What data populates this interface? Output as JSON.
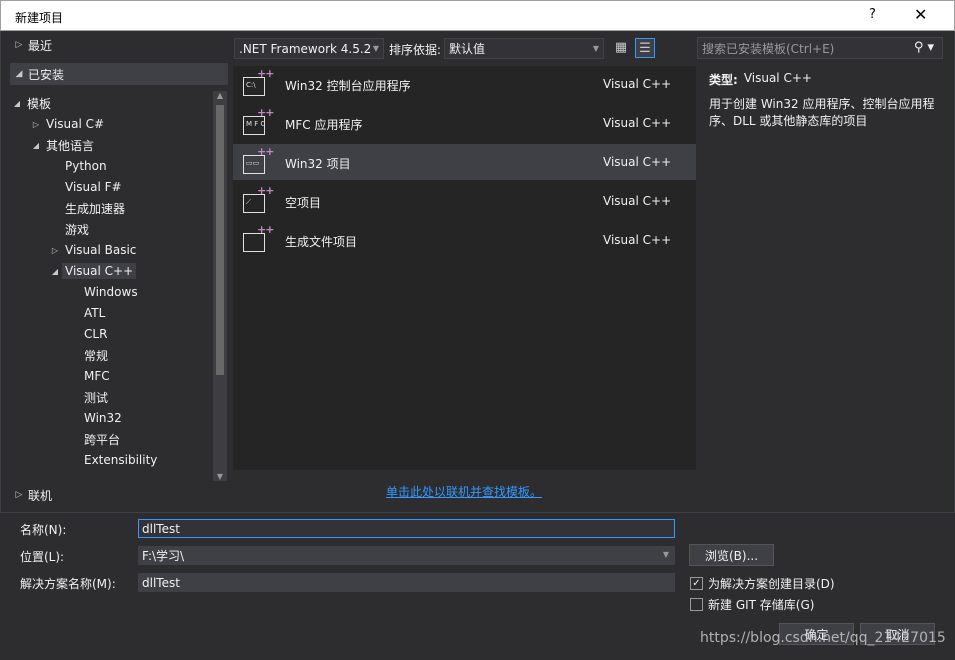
{
  "window": {
    "title": "新建项目",
    "help": "?",
    "close": "✕"
  },
  "left": {
    "recent": "最近",
    "installed": "已安装",
    "online": "联机",
    "tree": [
      {
        "label": "模板",
        "arrow": "◢"
      },
      {
        "label": "Visual C#",
        "arrow": "▷"
      },
      {
        "label": "其他语言",
        "arrow": "◢"
      },
      {
        "label": "Python",
        "arrow": ""
      },
      {
        "label": "Visual F#",
        "arrow": ""
      },
      {
        "label": "生成加速器",
        "arrow": ""
      },
      {
        "label": "游戏",
        "arrow": ""
      },
      {
        "label": "Visual Basic",
        "arrow": "▷"
      },
      {
        "label": "Visual C++",
        "arrow": "◢"
      },
      {
        "label": "Windows",
        "arrow": ""
      },
      {
        "label": "ATL",
        "arrow": ""
      },
      {
        "label": "CLR",
        "arrow": ""
      },
      {
        "label": "常规",
        "arrow": ""
      },
      {
        "label": "MFC",
        "arrow": ""
      },
      {
        "label": "测试",
        "arrow": ""
      },
      {
        "label": "Win32",
        "arrow": ""
      },
      {
        "label": "跨平台",
        "arrow": ""
      },
      {
        "label": "Extensibility",
        "arrow": ""
      }
    ]
  },
  "toolbar": {
    "framework": ".NET Framework 4.5.2",
    "sort_label": "排序依据:",
    "sort_value": "默认值",
    "grid_view": "▦",
    "list_view": "☰"
  },
  "search": {
    "placeholder": "搜索已安装模板(Ctrl+E)",
    "icon": "⚲"
  },
  "templates": [
    {
      "name": "Win32 控制台应用程序",
      "lang": "Visual C++",
      "icon_text": "C:\\"
    },
    {
      "name": "MFC 应用程序",
      "lang": "Visual C++",
      "icon_text": "M F C"
    },
    {
      "name": "Win32 项目",
      "lang": "Visual C++",
      "icon_text": "▭▭"
    },
    {
      "name": "空项目",
      "lang": "Visual C++",
      "icon_text": "⟋"
    },
    {
      "name": "生成文件项目",
      "lang": "Visual C++",
      "icon_text": ""
    }
  ],
  "description": {
    "type_label": "类型:",
    "type_value": "Visual C++",
    "text": "用于创建 Win32 应用程序、控制台应用程序、DLL 或其他静态库的项目"
  },
  "online_link": "单击此处以联机并查找模板。",
  "form": {
    "name_label": "名称(N):",
    "name_value": "dllTest",
    "location_label": "位置(L):",
    "location_value": "F:\\学习\\",
    "solution_label": "解决方案名称(M):",
    "solution_value": "dllTest",
    "browse": "浏览(B)...",
    "create_dir": "为解决方案创建目录(D)",
    "create_dir_checked": "✓",
    "git": "新建 GIT 存储库(G)",
    "ok": "确定",
    "cancel": "取消"
  },
  "watermark": "https://blog.csdn.net/qq_21427015"
}
